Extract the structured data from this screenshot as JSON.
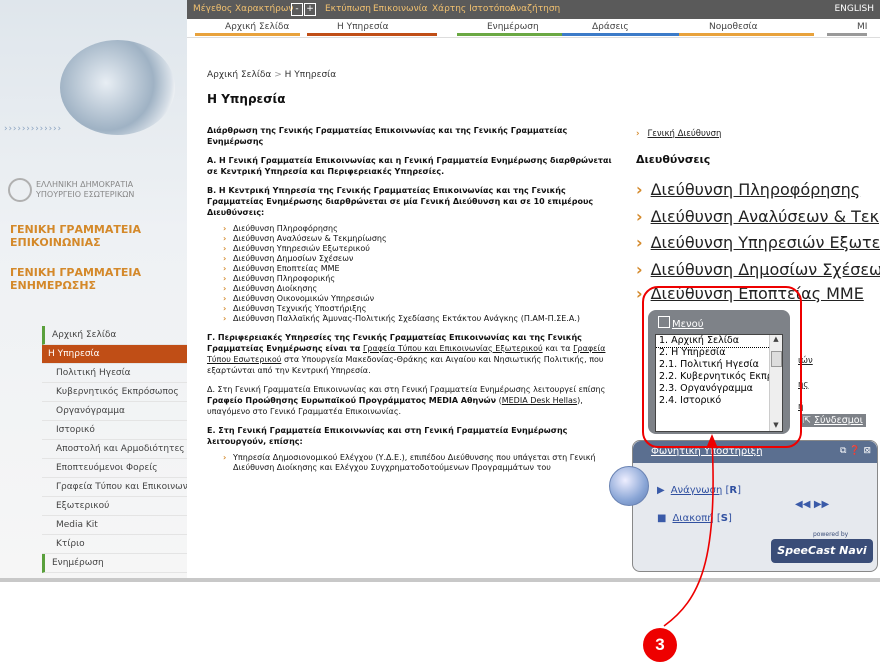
{
  "topbar": {
    "font_size_label": "Μέγεθος Χαρακτήρων",
    "minus": "-",
    "plus": "+",
    "links": [
      "Εκτύπωση",
      "Επικοινωνία",
      "Χάρτης Ιστοτόπου",
      "Αναζήτηση"
    ],
    "english": "ENGLISH"
  },
  "mainnav": [
    "Αρχική Σελίδα",
    "Η Υπηρεσία",
    "Ενημέρωση",
    "Δράσεις",
    "Νομοθεσία",
    "ΜΙ"
  ],
  "mainnav_colors": [
    "#e8a23c",
    "#c04e16",
    "#6aa843",
    "#3c7bc8",
    "#e8a23c",
    "#999999"
  ],
  "left": {
    "dots": "› › › › › › › › › › › › ›",
    "org_line1": "ΕΛΛΗΝΙΚΗ ΔΗΜΟΚΡΑΤΙΑ",
    "org_line2": "ΥΠΟΥΡΓΕΙΟ ΕΣΩΤΕΡΙΚΩΝ",
    "gs1_line1": "ΓΕΝΙΚΗ ΓΡΑΜΜΑΤΕΙΑ",
    "gs1_line2": "ΕΠΙΚΟΙΝΩΝΙΑΣ",
    "gs2_line1": "ΓΕΝΙΚΗ ΓΡΑΜΜΑΤΕΙΑ",
    "gs2_line2": "ΕΝΗΜΕΡΩΣΗΣ",
    "menu": [
      {
        "label": "Αρχική Σελίδα",
        "kind": "top"
      },
      {
        "label": "Η Υπηρεσία",
        "kind": "active"
      },
      {
        "label": "Πολιτική Ηγεσία",
        "kind": "sub"
      },
      {
        "label": "Κυβερνητικός Εκπρόσωπος",
        "kind": "sub"
      },
      {
        "label": "Οργανόγραμμα",
        "kind": "sub"
      },
      {
        "label": "Ιστορικό",
        "kind": "sub"
      },
      {
        "label": "Αποστολή και Αρμοδιότητες",
        "kind": "sub"
      },
      {
        "label": "Εποπτευόμενοι Φορείς",
        "kind": "sub"
      },
      {
        "label": "Γραφεία Τύπου και Επικοινωνίας",
        "kind": "sub"
      },
      {
        "label": "Εξωτερικού",
        "kind": "sub"
      },
      {
        "label": "Media Kit",
        "kind": "sub"
      },
      {
        "label": "Κτίριο",
        "kind": "sub"
      },
      {
        "label": "Ενημέρωση",
        "kind": "top"
      }
    ]
  },
  "breadcrumb": {
    "home": "Αρχική Σελίδα",
    "sep": ">",
    "current": "Η Υπηρεσία"
  },
  "page_title": "Η Υπηρεσία",
  "body": {
    "heading": "Διάρθρωση  της Γενικής Γραμματείας Επικοινωνίας και της Γενικής Γραμματείας Ενημέρωσης",
    "a": "Α. Η Γενική Γραμματεία Επικοινωνίας και η Γενική Γραμματεία Ενημέρωσης διαρθρώνεται σε Κεντρική Υπηρεσία και Περιφερειακές Υπηρεσίες.",
    "b": "Β. Η Κεντρική Υπηρεσία της Γενικής Γραμματείας Επικοινωνίας και της Γενικής Γραμματείας Ενημέρωσης διαρθρώνεται σε μία Γενική Διεύθυνση και σε 10 επιμέρους Διευθύνσεις:",
    "directorates": [
      "Διεύθυνση Πληροφόρησης",
      "Διεύθυνση Αναλύσεων & Τεκμηρίωσης",
      "Διεύθυνση Υπηρεσιών Εξωτερικού",
      "Διεύθυνση Δημοσίων Σχέσεων",
      "Διεύθυνση Εποπτείας ΜΜΕ",
      "Διεύθυνση Πληροφορικής",
      "Διεύθυνση Διοίκησης",
      "Διεύθυνση Οικονομικών Υπηρεσιών",
      "Διεύθυνση Τεχνικής Υποστήριξης",
      "Διεύθυνση Παλλαϊκής Άμυνας-Πολιτικής Σχεδίασης Εκτάκτου Ανάγκης (Π.ΑΜ-Π.ΣΕ.Α.)"
    ],
    "g_bold": "Γ. Περιφερειακές Υπηρεσίες της Γενικής Γραμματείας Επικοινωνίας και της Γενικής Γραμματείας Ενημέρωσης είναι τα",
    "g_link1": "Γραφεία Τύπου και Επικοινωνίας Εξωτερικού",
    "g_mid": "και τα",
    "g_link2": "Γραφεία Τύπου Εσωτερικού",
    "g_rest": "στα Υπουργεία Μακεδονίας-Θράκης και Αιγαίου και Νησιωτικής Πολιτικής, που εξαρτώνται από την Κεντρική Υπηρεσία.",
    "d_start": "Δ. Στη Γενική Γραμματεία Επικοινωνίας και στη Γενική Γραμματεία Ενημέρωσης λειτουργεί επίσης",
    "d_bold": "Γραφείο Προώθησης Ευρωπαϊκού Προγράμματος MEDIA Αθηνών",
    "d_link": "MEDIA Desk Hellas",
    "d_end": ", υπαγόμενο στο Γενικό Γραμματέα Επικοινωνίας.",
    "e": "Ε. Στη Γενική Γραμματεία Επικοινωνίας και στη Γενική Γραμματεία Ενημέρωσης λειτουργούν, επίσης:",
    "e_item": "Υπηρεσία Δημοσιονομικού Ελέγχου (Υ.Δ.Ε.), επιπέδου Διεύθυνσης που υπάγεται στη Γενική Διεύθυνση Διοίκησης και Ελέγχου Συγχρηματοδοτούμενων Προγραμμάτων του"
  },
  "right": {
    "general": "Γενική Διεύθυνση",
    "heading": "Διευθύνσεις",
    "links": [
      "Διεύθυνση Πληροφόρησης",
      "Διεύθυνση Αναλύσεων & Τεκμηρίωσης",
      "Διεύθυνση Υπηρεσιών Εξωτερικού",
      "Διεύθυνση Δημοσίων Σχέσεων",
      "Διεύθυνση Εποπτείας ΜΜΕ"
    ],
    "peek": [
      "ιών",
      "ής",
      "ή"
    ]
  },
  "menu_widget": {
    "title": "Μενού",
    "items": [
      "1. Αρχική Σελίδα",
      "2. Η Υπηρεσία",
      "2.1. Πολιτική Ηγεσία",
      "2.2. Κυβερνητικός Εκπρ",
      "2.3. Οργανόγραμμα",
      "2.4. Ιστορικό"
    ],
    "links_label": "Σύνδεσμοι"
  },
  "audio_widget": {
    "title": "Φωνητική Υποστήριξη",
    "read_label": "Ανάγνωση",
    "read_key": "R",
    "stop_label": "Διακοπή",
    "stop_key": "S",
    "powered": "powered by",
    "brand": "SpeeCast Navi"
  },
  "annotation": {
    "number": "3",
    "color": "#e00000"
  }
}
